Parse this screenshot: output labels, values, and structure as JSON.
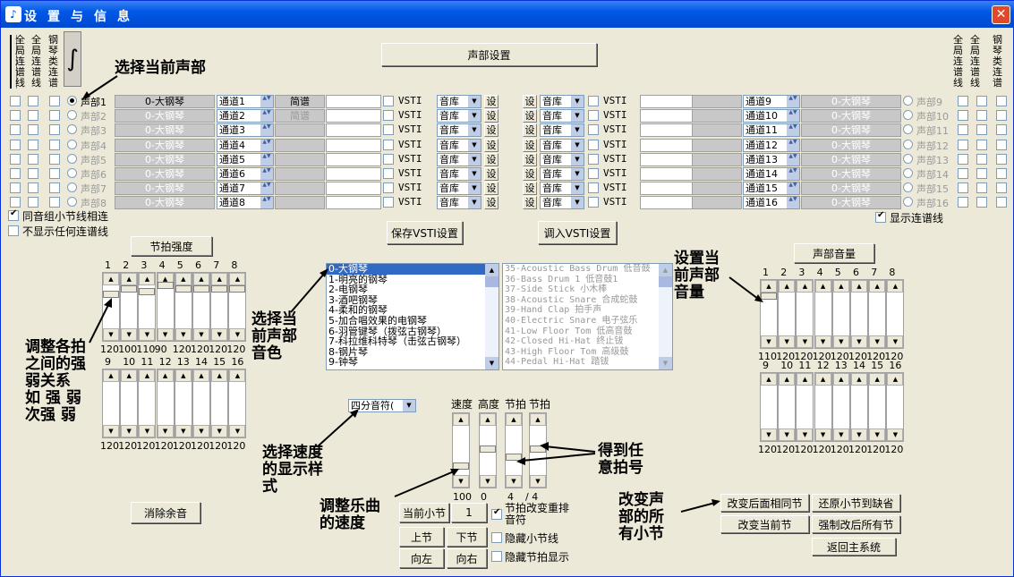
{
  "window": {
    "title": "设置与信息",
    "close": "✕"
  },
  "top": {
    "voice_settings": "声部设置",
    "left_vlabels": [
      "全局连谱线",
      "全局连谱线",
      "钢琴类连谱"
    ],
    "right_vlabels": [
      "全局连谱线",
      "全局连谱线",
      "钢琴类连谱"
    ]
  },
  "voices": [
    {
      "name": "声部1",
      "tone": "0-大钢琴",
      "channel": "通道1",
      "jp": "简谱",
      "active": true
    },
    {
      "name": "声部2",
      "tone": "0-大钢琴",
      "channel": "通道2",
      "jp": "简谱",
      "active": false
    },
    {
      "name": "声部3",
      "tone": "0-大钢琴",
      "channel": "通道3",
      "jp": "",
      "active": false
    },
    {
      "name": "声部4",
      "tone": "0-大钢琴",
      "channel": "通道4",
      "jp": "",
      "active": false
    },
    {
      "name": "声部5",
      "tone": "0-大钢琴",
      "channel": "通道5",
      "jp": "",
      "active": false
    },
    {
      "name": "声部6",
      "tone": "0-大钢琴",
      "channel": "通道6",
      "jp": "",
      "active": false
    },
    {
      "name": "声部7",
      "tone": "0-大钢琴",
      "channel": "通道7",
      "jp": "",
      "active": false
    },
    {
      "name": "声部8",
      "tone": "0-大钢琴",
      "channel": "通道8",
      "jp": "",
      "active": false
    }
  ],
  "voices_right": [
    {
      "name": "声部9",
      "tone": "0-大钢琴",
      "channel": "通道9"
    },
    {
      "name": "声部10",
      "tone": "0-大钢琴",
      "channel": "通道10"
    },
    {
      "name": "声部11",
      "tone": "0-大钢琴",
      "channel": "通道11"
    },
    {
      "name": "声部12",
      "tone": "0-大钢琴",
      "channel": "通道12"
    },
    {
      "name": "声部13",
      "tone": "0-大钢琴",
      "channel": "通道13"
    },
    {
      "name": "声部14",
      "tone": "0-大钢琴",
      "channel": "通道14"
    },
    {
      "name": "声部15",
      "tone": "0-大钢琴",
      "channel": "通道15"
    },
    {
      "name": "声部16",
      "tone": "0-大钢琴",
      "channel": "通道16"
    }
  ],
  "row_labels": {
    "vsti": "VSTI",
    "lib": "音库",
    "set": "设"
  },
  "options": {
    "same_group": "同音组小节线相连",
    "no_tie": "不显示任何连谱线",
    "show_tie": "显示连谱线"
  },
  "buttons": {
    "save_vsti": "保存VSTI设置",
    "load_vsti": "调入VSTI设置",
    "beat_strength": "节拍强度",
    "voice_volume": "声部音量",
    "clear_reverb": "消除余音",
    "cur_bar": "当前小节",
    "prev_bar": "上节",
    "next_bar": "下节",
    "left": "向左",
    "right": "向右",
    "change_after_same": "改变后面相同节",
    "restore_default": "还原小节到缺省",
    "change_current": "改变当前节",
    "force_after_all": "强制改后所有节",
    "back_main": "返回主系统"
  },
  "beat": {
    "top_nums": [
      "1",
      "2",
      "3",
      "4",
      "5",
      "6",
      "7",
      "8"
    ],
    "top_vals": [
      "120",
      "100",
      "110",
      "90",
      "120",
      "120",
      "120",
      "120"
    ],
    "bottom_nums": [
      "9",
      "10",
      "11",
      "12",
      "13",
      "14",
      "15",
      "16"
    ],
    "bottom_vals": [
      "120",
      "120",
      "120",
      "120",
      "120",
      "120",
      "120",
      "120"
    ]
  },
  "volume": {
    "top_nums": [
      "1",
      "2",
      "3",
      "4",
      "5",
      "6",
      "7",
      "8"
    ],
    "top_vals": [
      "110",
      "120",
      "120",
      "120",
      "120",
      "120",
      "120",
      "120"
    ],
    "bottom_nums": [
      "9",
      "10",
      "11",
      "12",
      "13",
      "14",
      "15",
      "16"
    ],
    "bottom_vals": [
      "120",
      "120",
      "120",
      "120",
      "120",
      "120",
      "120",
      "120"
    ]
  },
  "tone_list": [
    "0-大钢琴",
    "1-明亮的钢琴",
    "2-电钢琴",
    "3-酒吧钢琴",
    "4-柔和的钢琴",
    "5-加合唱效果的电钢琴",
    "6-羽管键琴（拨弦古钢琴）",
    "7-科拉维科特琴（击弦古钢琴）",
    "8-钢片琴",
    "9-钟琴"
  ],
  "drum_list": [
    "35-Acoustic Bass Drum  低音鼓",
    "36-Bass Drum 1 低音鼓1",
    "37-Side Stick 小木棒",
    "38-Acoustic Snare 合成蛇鼓",
    "39-Hand Clap 拍手声",
    "40-Electric Snare 电子弦乐",
    "41-Low Floor Tom 低高音鼓",
    "42-Closed Hi-Hat 终止钹",
    "43-High Floor Tom 高级鼓",
    "44-Pedal Hi-Hat 踏钹"
  ],
  "tempo": {
    "note_type": "四分音符(",
    "speed_label": "速度",
    "height_label": "高度",
    "beat_label": "节拍",
    "beat2_label": "节拍",
    "speed_val": "100",
    "height_val": "0",
    "beat_num": "4",
    "beat_den": "/ 4",
    "bar_num": "1"
  },
  "checks": {
    "rearrange": "节拍改变重排音符",
    "hide_bar": "隐藏小节线",
    "hide_beat": "隐藏节拍显示"
  },
  "annotations": {
    "select_voice": "选择当前声部",
    "adjust_beats": "调整各拍\n之间的强\n弱关系\n如 强 弱\n次强 弱",
    "select_tone": "选择当\n前声部\n音色",
    "set_volume": "设置当\n前声部\n音量",
    "select_speed": "选择速度\n的显示样\n式",
    "adjust_speed": "调整乐曲\n的速度",
    "get_beat": "得到任\n意拍号",
    "change_all": "改变声\n部的所\n有小节"
  }
}
